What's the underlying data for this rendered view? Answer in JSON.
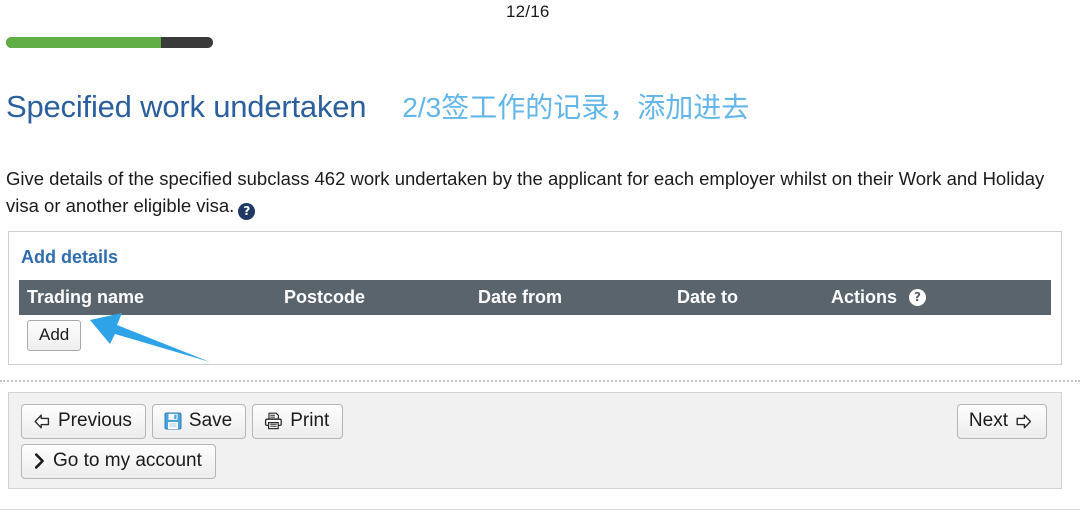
{
  "progress": {
    "counter_label": "12/16",
    "current_step": 12,
    "total_steps": 16,
    "percent": 75,
    "fill_color": "#61ae46",
    "track_color": "#3a3a3a"
  },
  "heading": {
    "title": "Specified work undertaken",
    "annotation": "2/3签工作的记录，添加进去",
    "title_color": "#2c5f9e",
    "annotation_color": "#63b6e8"
  },
  "intro": {
    "text": "Give details of the specified subclass 462 work undertaken by the applicant for each employer whilst on their Work and Holiday visa or another eligible visa.",
    "help_icon": "help-circle-icon",
    "help_glyph": "?"
  },
  "details_panel": {
    "section_label": "Add details",
    "table": {
      "columns": [
        "Trading name",
        "Postcode",
        "Date from",
        "Date to",
        "Actions"
      ],
      "actions_help_glyph": "?",
      "header_bg": "#5a646d",
      "rows": [],
      "add_button_label": "Add"
    }
  },
  "nav_bar": {
    "previous_label": "Previous",
    "save_label": "Save",
    "print_label": "Print",
    "account_label": "Go to my account",
    "next_label": "Next"
  },
  "annotation": {
    "arrow_color": "#2ea3e8",
    "points_to": "Add"
  }
}
